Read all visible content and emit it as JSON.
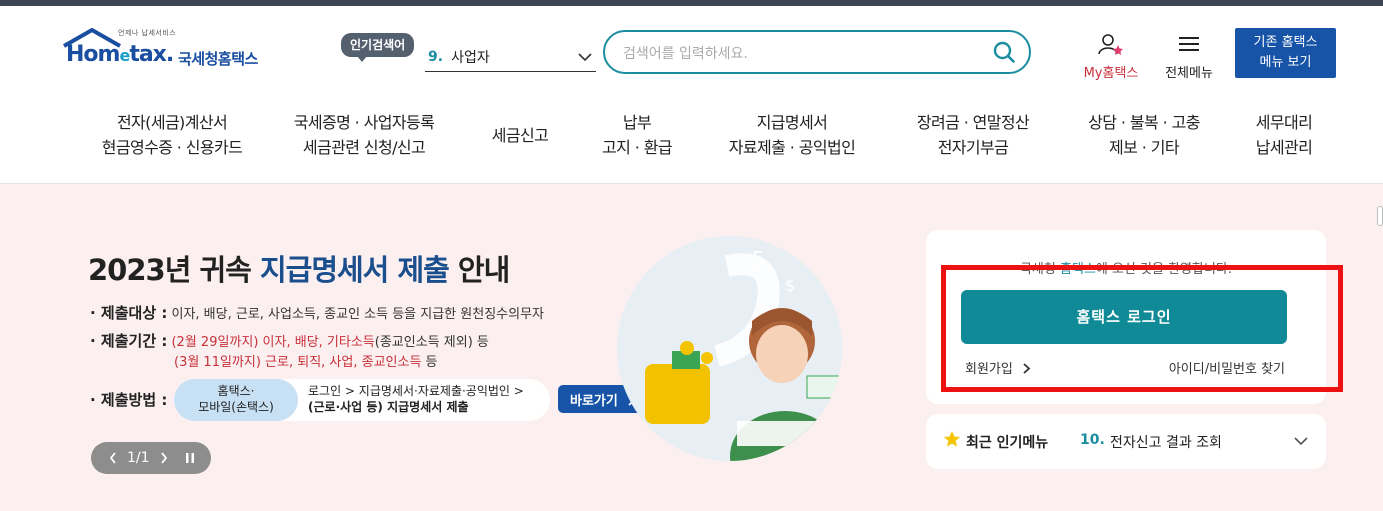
{
  "logo": {
    "small": "언제나 납세서비스",
    "word_a": "Hom",
    "word_e": "e",
    "word_b": "tax.",
    "korean": "국세청홈택스"
  },
  "popular": {
    "badge": "인기검색어",
    "number": "9.",
    "term": "사업자"
  },
  "search": {
    "placeholder": "검색어를 입력하세요."
  },
  "my_hometax": {
    "label": "My홈택스"
  },
  "all_menu": {
    "label": "전체메뉴"
  },
  "old_menu": {
    "line1": "기존 홈택스",
    "line2": "메뉴 보기"
  },
  "gnb": [
    {
      "line1": "전자(세금)계산서",
      "line2": "현금영수증 · 신용카드"
    },
    {
      "line1": "국세증명 · 사업자등록",
      "line2": "세금관련 신청/신고"
    },
    {
      "line1": "세금신고",
      "line2": ""
    },
    {
      "line1": "납부",
      "line2": "고지 · 환급"
    },
    {
      "line1": "지급명세서",
      "line2": "자료제출 · 공익법인"
    },
    {
      "line1": "장려금 · 연말정산",
      "line2": "전자기부금"
    },
    {
      "line1": "상담 · 불복 · 고충",
      "line2": "제보 · 기타"
    },
    {
      "line1": "세무대리",
      "line2": "납세관리"
    }
  ],
  "banner": {
    "title_a": "2023년 귀속 ",
    "title_hl": "지급명세서 제출",
    "title_b": " 안내",
    "target_key": "· 제출대상 :",
    "target_val": "이자, 배당, 근로, 사업소득, 종교인 소득 등을 지급한 원천징수의무자",
    "period_key": "· 제출기간 :",
    "period1_red": "(2월 29일까지) 이자, 배당, 기타소득",
    "period1_rest": "(종교인소득 제외) 등",
    "period2_red": "(3월 11일까지) 근로, 퇴직, 사업, 종교인소득",
    "period2_rest": " 등",
    "method_key": "· 제출방법 :",
    "method_pill_1": "홈택스·",
    "method_pill_2": "모바일(손택스)",
    "method_text_1": "로그인 > 지급명세서·자료제출·공익법인 >",
    "method_text_2": "(근로·사업 등) 지급명세서 제출",
    "goto": "바로가기",
    "pager": "1/1"
  },
  "login": {
    "welcome_a": "국세청 ",
    "welcome_accent": "홈택스",
    "welcome_b": "에 오신 것을 환영합니다.",
    "button": "홈택스 로그인",
    "signup": "회원가입",
    "find": "아이디/비밀번호 찾기"
  },
  "recent": {
    "title": "최근 인기메뉴",
    "number": "10.",
    "term": "전자신고 결과 조회"
  },
  "colors": {
    "accent": "#0f8a96",
    "brand": "#1754a8",
    "highlight": "#ee1111"
  }
}
